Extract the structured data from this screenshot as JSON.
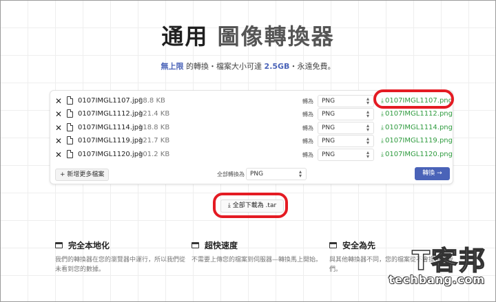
{
  "header": {
    "title_part1": "通用",
    "title_part2": "圖像轉換器",
    "subtitle_highlight1": "無上限",
    "subtitle_text1": " 的轉換・檔案大小可達 ",
    "subtitle_highlight2": "2.5GB",
    "subtitle_text2": "・永遠免費。"
  },
  "files": [
    {
      "name": "0107IMGL1107.jpg",
      "size": "98.8 KB",
      "convert_label": "轉為",
      "format": "PNG",
      "download": "0107IMGL1107.png"
    },
    {
      "name": "0107IMGL1112.jpg",
      "size": "121.4 KB",
      "convert_label": "轉為",
      "format": "PNG",
      "download": "0107IMGL1112.png"
    },
    {
      "name": "0107IMGL1114.jpg",
      "size": "118.8 KB",
      "convert_label": "轉為",
      "format": "PNG",
      "download": "0107IMGL1114.png"
    },
    {
      "name": "0107IMGL1119.jpg",
      "size": "121.7 KB",
      "convert_label": "轉為",
      "format": "PNG",
      "download": "0107IMGL1119.png"
    },
    {
      "name": "0107IMGL1120.jpg",
      "size": "101.2 KB",
      "convert_label": "轉為",
      "format": "PNG",
      "download": "0107IMGL1120.png"
    }
  ],
  "toolbar": {
    "add_more": "新增更多檔案",
    "convert_all_label": "全部轉換為",
    "convert_all_format": "PNG",
    "convert_button": "轉換 →"
  },
  "download_all": "全部下載為 .tar",
  "features": [
    {
      "title": "完全本地化",
      "desc": "我們的轉換器在您的瀏覽器中運行，所以我們從未看到您的數據。"
    },
    {
      "title": "超快速度",
      "desc": "不需要上傳您的檔案到伺服器—轉換馬上開始。"
    },
    {
      "title": "安全為先",
      "desc": "與其他轉換器不同，您的檔案從不會提供給我們。"
    }
  ],
  "watermark": {
    "cn": "T客邦",
    "en": "techbang.com"
  },
  "colors": {
    "accent": "#4a63b8",
    "download_green": "#2e9b3e",
    "highlight_ring": "#e41b23"
  },
  "icons": {
    "remove": "close-icon",
    "file": "file-image-icon",
    "download": "download-icon",
    "plus": "plus-icon",
    "feature": "window-icon"
  }
}
